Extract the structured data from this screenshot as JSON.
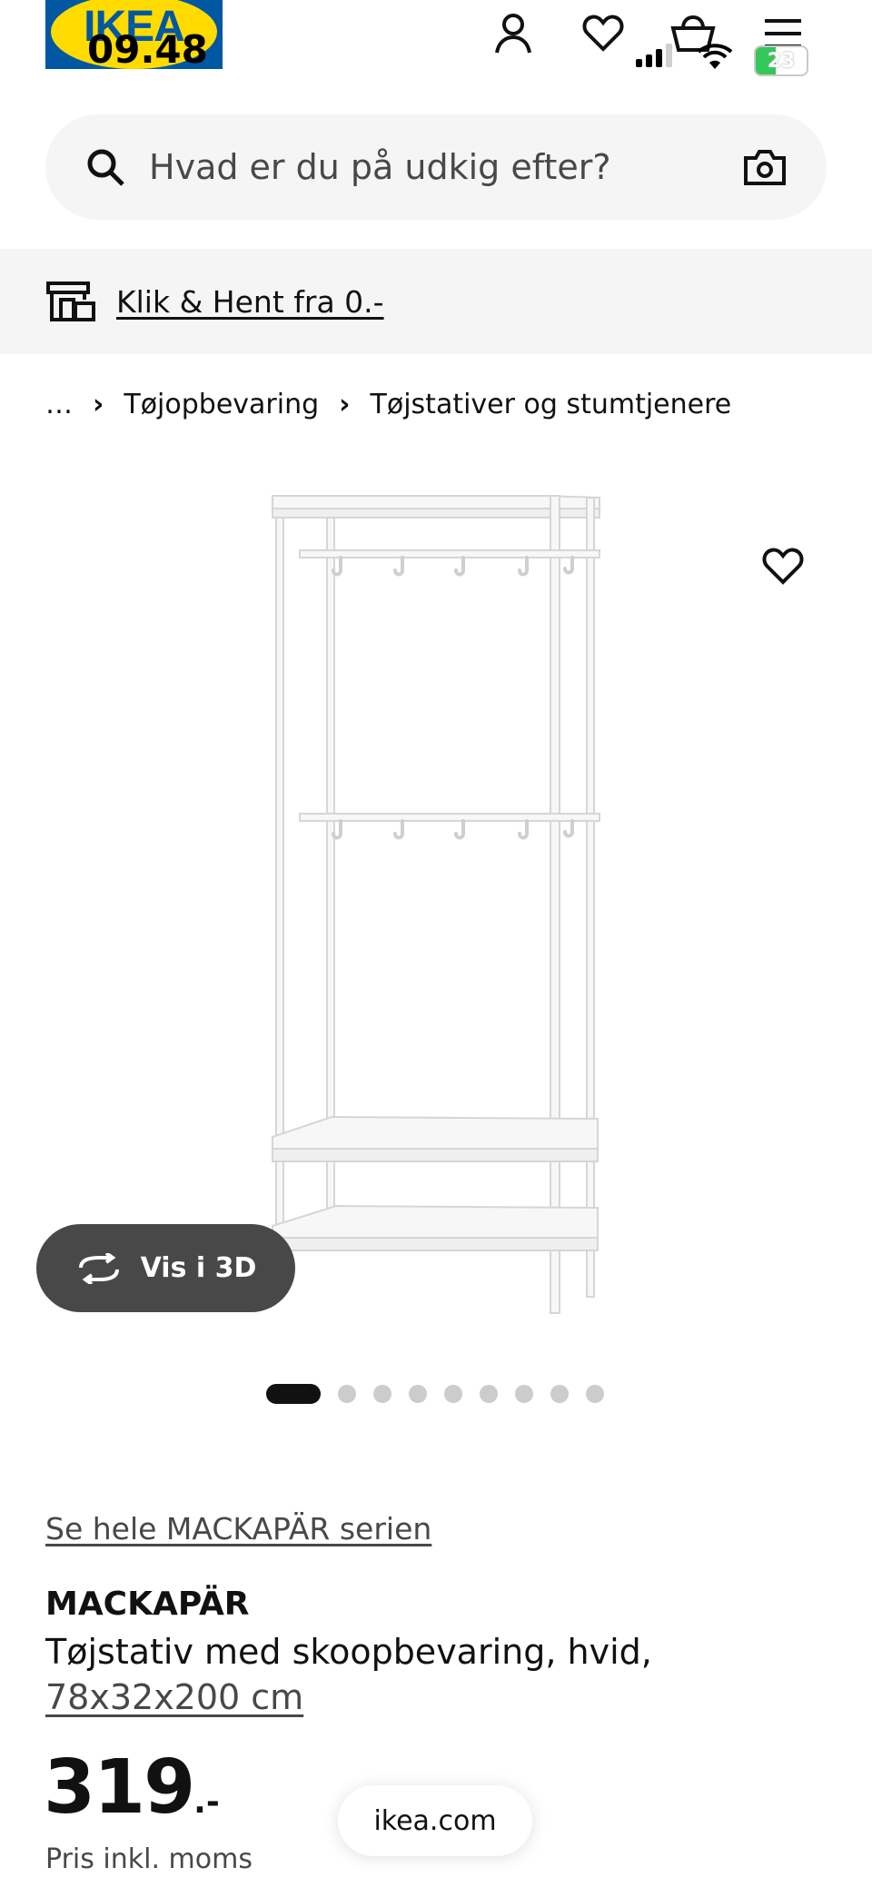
{
  "status_bar": {
    "time": "09.48",
    "battery": "23"
  },
  "header": {
    "logo_text": "IKEA",
    "icons": [
      "user-icon",
      "heart-icon",
      "basket-icon",
      "menu-icon"
    ]
  },
  "search": {
    "placeholder": "Hvad er du på udkig efter?"
  },
  "promo": {
    "label": "Klik & Hent fra 0.-"
  },
  "breadcrumb": {
    "ellipsis": "…",
    "items": [
      "Tøjopbevaring",
      "Tøjstativer og stumtjenere"
    ]
  },
  "gallery": {
    "view_3d_label": "Vis i 3D",
    "dot_count": 9,
    "active_index": 0
  },
  "product": {
    "series_link": "Se hele MACKAPÄR serien",
    "name": "MACKAPÄR",
    "description": "Tøjstativ med skoopbevaring, hvid,",
    "size": "78x32x200 cm",
    "price_int": "319",
    "price_dec": ".-",
    "price_note": "Pris inkl. moms"
  },
  "browser": {
    "url": "ikea.com"
  },
  "colors": {
    "brand_blue": "#0058a3",
    "brand_yellow": "#ffdb00",
    "text": "#111111",
    "muted": "#484848",
    "surface": "#f5f5f5"
  }
}
